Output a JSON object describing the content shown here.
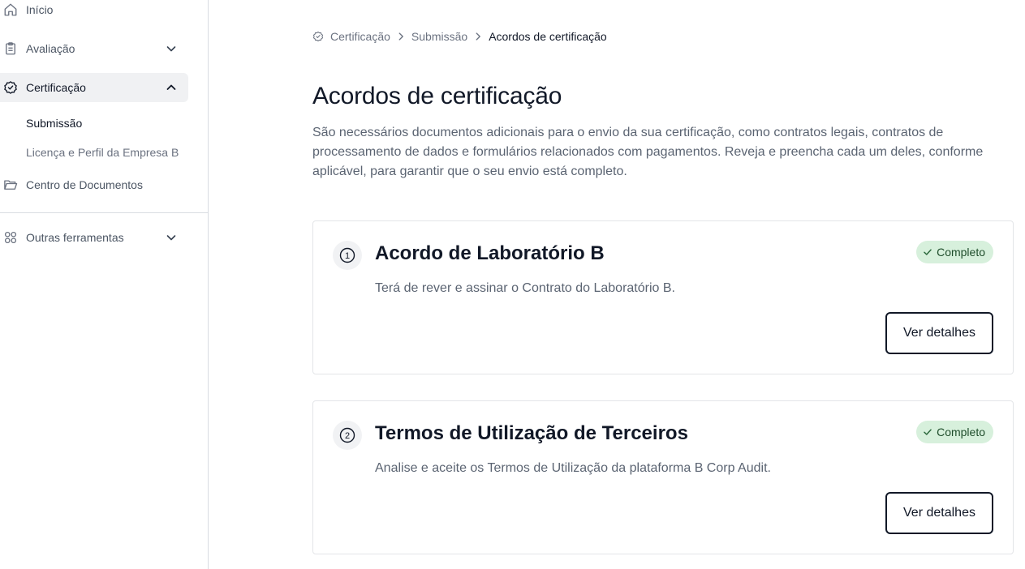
{
  "sidebar": {
    "items": [
      {
        "label": "Início",
        "icon": "home-icon"
      },
      {
        "label": "Avaliação",
        "icon": "clipboard-icon"
      },
      {
        "label": "Certificação",
        "icon": "badge-check-icon"
      },
      {
        "label": "Centro de Documentos",
        "icon": "folder-icon"
      },
      {
        "label": "Outras ferramentas",
        "icon": "grid-icon"
      }
    ],
    "sub_items": [
      {
        "label": "Submissão"
      },
      {
        "label": "Licença e Perfil da Empresa B"
      }
    ]
  },
  "breadcrumb": {
    "items": [
      "Certificação",
      "Submissão",
      "Acordos de certificação"
    ]
  },
  "page": {
    "title": "Acordos de certificação",
    "description": "São necessários documentos adicionais para o envio da sua certificação, como contratos legais, contratos de processamento de dados e formulários relacionados com pagamentos. Reveja e preencha cada um deles, conforme aplicável, para garantir que o seu envio está completo."
  },
  "cards": [
    {
      "step": "1",
      "title": "Acordo de Laboratório B",
      "description": "Terá de rever e assinar o Contrato do Laboratório B.",
      "status": "Completo",
      "button": "Ver detalhes"
    },
    {
      "step": "2",
      "title": "Termos de Utilização de Terceiros",
      "description": "Analise e aceite os Termos de Utilização da plataforma B Corp Audit.",
      "status": "Completo",
      "button": "Ver detalhes"
    }
  ],
  "colors": {
    "badge_bg": "#d7f0dc",
    "badge_text": "#1f4d2b",
    "active_nav_bg": "#f0f1f3"
  }
}
